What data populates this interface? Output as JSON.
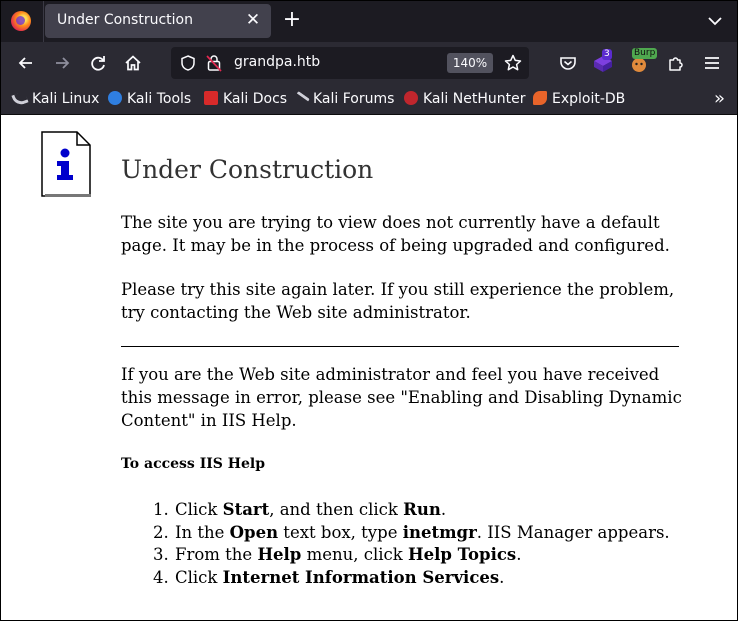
{
  "browser": {
    "tab": {
      "title": "Under Construction",
      "close": "✕"
    },
    "new_tab": "+",
    "url": "grandpa.htb",
    "zoom": "140%",
    "extension_badges": {
      "notes": "3",
      "burp": "Burp"
    },
    "bookmarks": [
      {
        "label": "Kali Linux",
        "icon": "kali-dragon-icon"
      },
      {
        "label": "Kali Tools",
        "icon": "kali-tools-icon"
      },
      {
        "label": "Kali Docs",
        "icon": "kali-docs-icon"
      },
      {
        "label": "Kali Forums",
        "icon": "kali-forums-icon"
      },
      {
        "label": "Kali NetHunter",
        "icon": "nethunter-icon"
      },
      {
        "label": "Exploit-DB",
        "icon": "exploit-db-icon"
      }
    ],
    "colors": {
      "tabstrip": "#1c1b22",
      "toolbar": "#2b2a33",
      "active_tab": "#42414d",
      "text": "#fbfbfe"
    }
  },
  "page": {
    "title": "Under Construction",
    "p1": "The site you are trying to view does not currently have a default page. It may be in the process of being upgraded and configured.",
    "p2": "Please try this site again later. If you still experience the problem, try contacting the Web site administrator.",
    "p3": "If you are the Web site administrator and feel you have received this message in error, please see \"Enabling and Disabling Dynamic Content\" in IIS Help.",
    "help_heading": "To access IIS Help",
    "steps": [
      {
        "n": "1.",
        "a": "Click ",
        "b": "Start",
        "c": ", and then click ",
        "d": "Run",
        "e": "."
      },
      {
        "n": "2.",
        "a": "In the ",
        "b": "Open",
        "c": " text box, type ",
        "d": "inetmgr",
        "e": ". IIS Manager appears."
      },
      {
        "n": "3.",
        "a": "From the ",
        "b": "Help",
        "c": " menu, click ",
        "d": "Help Topics",
        "e": "."
      },
      {
        "n": "4.",
        "a": "Click ",
        "b": "Internet Information Services",
        "c": "",
        "d": "",
        "e": "."
      }
    ]
  }
}
